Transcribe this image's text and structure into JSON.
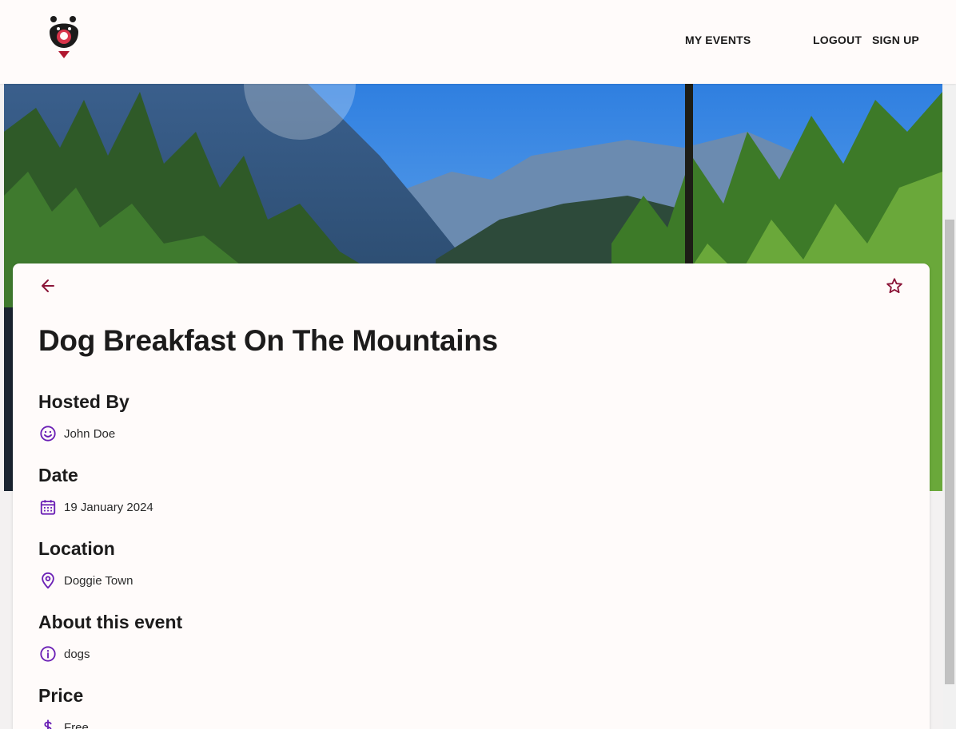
{
  "nav": {
    "my_events": "MY EVENTS",
    "logout": "LOGOUT",
    "sign_up": "SIGN UP"
  },
  "event": {
    "title": "Dog Breakfast On The Mountains",
    "sections": {
      "hosted_by": {
        "heading": "Hosted By",
        "value": "John Doe",
        "icon": "smiley-face-icon"
      },
      "date": {
        "heading": "Date",
        "value": "19 January 2024",
        "icon": "calendar-icon"
      },
      "location": {
        "heading": "Location",
        "value": "Doggie Town",
        "icon": "map-pin-icon"
      },
      "about": {
        "heading": "About this event",
        "value": "dogs",
        "icon": "info-icon"
      },
      "price": {
        "heading": "Price",
        "value": "Free",
        "icon": "dollar-icon"
      }
    }
  },
  "colors": {
    "accent_red": "#8b1538",
    "icon_purple": "#6a1fb5",
    "surface": "#fffbfa"
  }
}
